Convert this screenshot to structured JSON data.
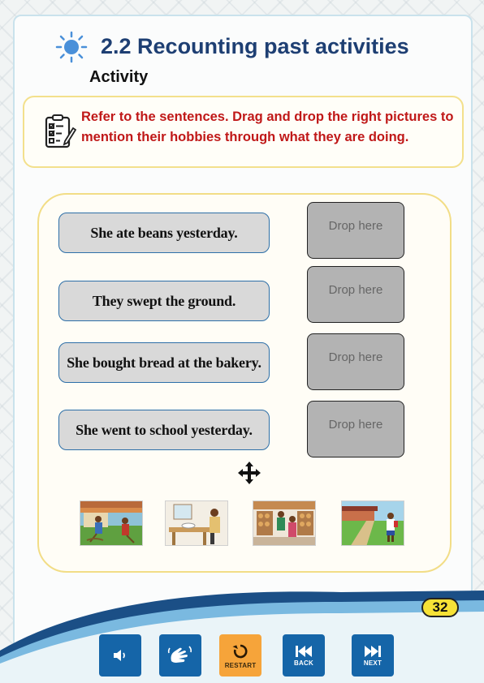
{
  "header": {
    "title": "2.2 Recounting past activities",
    "subtitle": "Activity"
  },
  "instructions": {
    "text": "Refer to the sentences. Drag and drop the right pictures to mention their hobbies through what they are doing."
  },
  "sentences": [
    "She ate beans yesterday.",
    "They swept the ground.",
    "She bought bread at the bakery.",
    "She went to school yesterday."
  ],
  "dropzones": [
    "Drop here",
    "Drop here",
    "Drop here",
    "Drop here"
  ],
  "pictures": [
    {
      "icon": "sweeping-picture"
    },
    {
      "icon": "eating-picture"
    },
    {
      "icon": "bakery-picture"
    },
    {
      "icon": "school-picture"
    }
  ],
  "footer": {
    "page_number": "32",
    "buttons": {
      "audio": "",
      "sign_language": "",
      "restart": "RESTART",
      "back": "BACK",
      "next": "NEXT"
    }
  },
  "colors": {
    "title": "#1e3f73",
    "instruction": "#c01818",
    "nav_button": "#1565a8",
    "restart_button": "#f6a43a",
    "page_badge": "#f7e236"
  }
}
